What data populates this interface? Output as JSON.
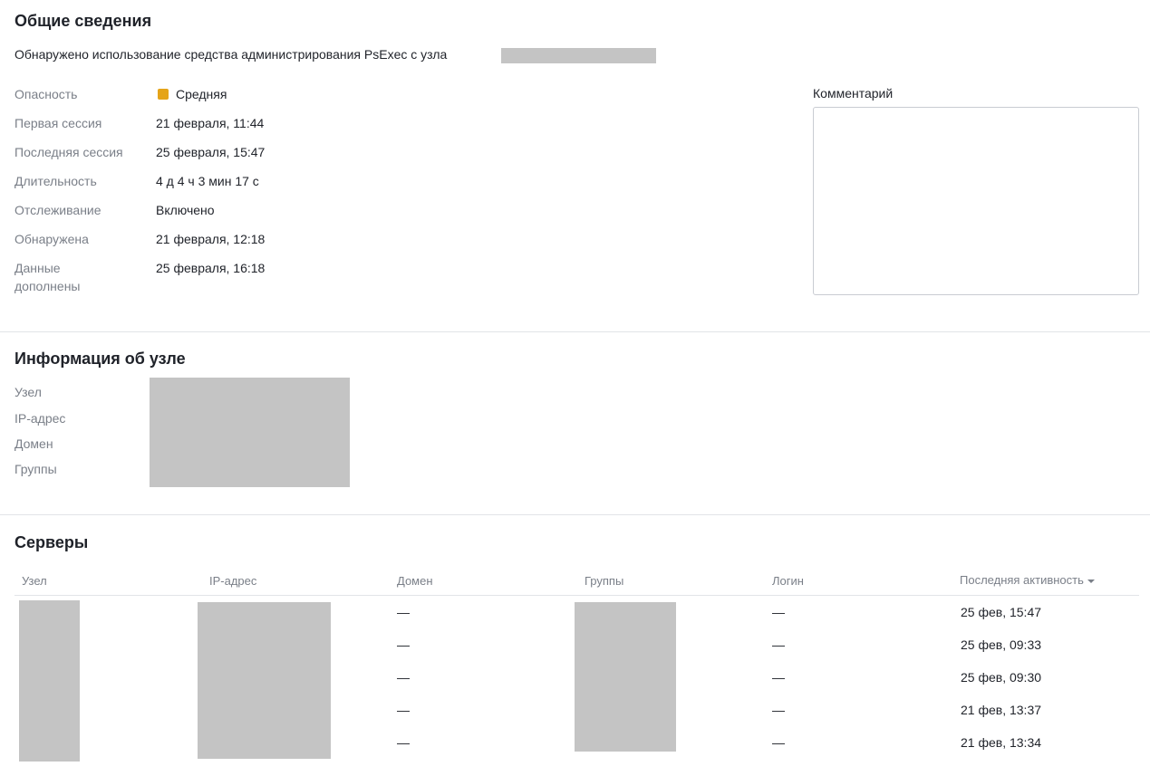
{
  "general": {
    "title": "Общие сведения",
    "description": "Обнаружено использование средства администрирования PsExec с узла",
    "fields": [
      {
        "label": "Опасность",
        "value": "Средняя"
      },
      {
        "label": "Первая сессия",
        "value": "21 февраля, 11:44"
      },
      {
        "label": "Последняя сессия",
        "value": "25 февраля, 15:47"
      },
      {
        "label": "Длительность",
        "value": "4 д 4 ч 3 мин 17 с"
      },
      {
        "label": "Отслеживание",
        "value": "Включено"
      },
      {
        "label": "Обнаружена",
        "value": "21 февраля, 12:18"
      },
      {
        "label": "Данные\nдополнены",
        "value": "25 февраля, 16:18"
      }
    ],
    "severity_color": "#e5a419",
    "comment_label": "Комментарий",
    "comment_value": ""
  },
  "host_info": {
    "title": "Информация об узле",
    "labels": [
      "Узел",
      "IP-адрес",
      "Домен",
      "Группы"
    ]
  },
  "servers": {
    "title": "Серверы",
    "columns": [
      "Узел",
      "IP-адрес",
      "Домен",
      "Группы",
      "Логин",
      "Последняя активность"
    ],
    "sort_icon": "caret-down-icon",
    "rows": [
      {
        "domain": "—",
        "login": "—",
        "last_activity": "25 фев, 15:47"
      },
      {
        "domain": "—",
        "login": "—",
        "last_activity": "25 фев, 09:33"
      },
      {
        "domain": "—",
        "login": "—",
        "last_activity": "25 фев, 09:30"
      },
      {
        "domain": "—",
        "login": "—",
        "last_activity": "21 фев, 13:37"
      },
      {
        "domain": "—",
        "login": "—",
        "last_activity": "21 фев, 13:34"
      }
    ]
  }
}
